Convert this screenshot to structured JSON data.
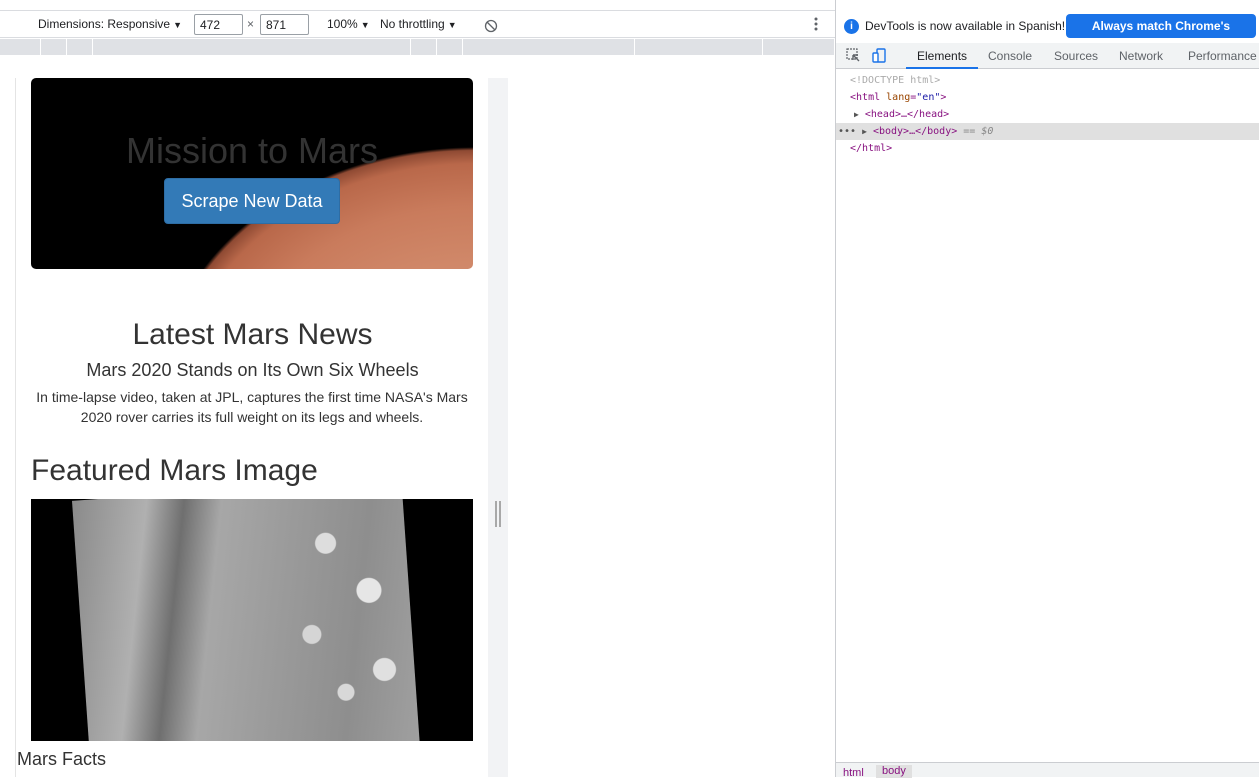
{
  "toolbar": {
    "dimensions_label": "Dimensions: Responsive",
    "width": "472",
    "times": "×",
    "height": "871",
    "zoom": "100%",
    "throttling": "No throttling",
    "more_icon": "kebab-vertical-icon",
    "rotate_icon": "rotate-off-icon"
  },
  "page": {
    "jumbotron_title": "Mission to Mars",
    "scrape_button": "Scrape New Data",
    "news_heading": "Latest Mars News",
    "news_title": "Mars 2020 Stands on Its Own Six Wheels",
    "news_paragraph": "In time-lapse video, taken at JPL, captures the first time NASA's Mars 2020 rover carries its full weight on its legs and wheels.",
    "featured_heading": "Featured Mars Image",
    "facts_heading": "Mars Facts"
  },
  "devtools": {
    "info_text": "DevTools is now available in Spanish!",
    "match_button": "Always match Chrome's language",
    "tabs": [
      "Elements",
      "Console",
      "Sources",
      "Network",
      "Performance"
    ],
    "active_tab": "Elements",
    "dom": {
      "doctype": "<!DOCTYPE html>",
      "html_open_tag": "html",
      "html_attr": "lang",
      "html_attr_value": "\"en\"",
      "head": "<head>…</head>",
      "body": "<body>…</body>",
      "body_suffix": "== $0",
      "html_close": "</html>",
      "dots": "•••"
    },
    "breadcrumbs": [
      "html",
      "body"
    ]
  },
  "colors": {
    "accent_blue": "#1a73e8",
    "bootstrap_primary": "#337ab7",
    "tag_purple": "#881280"
  }
}
